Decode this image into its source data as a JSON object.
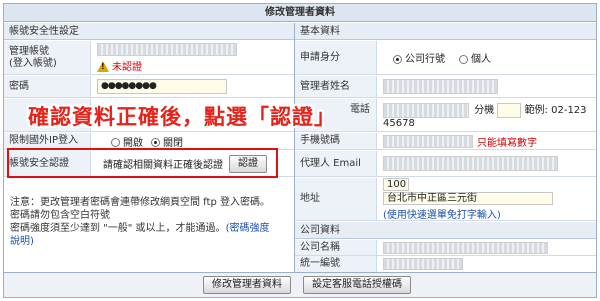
{
  "page": {
    "title": "修改管理者資料"
  },
  "left": {
    "section_title": "帳號安全性設定",
    "account": {
      "label_line1": "管理帳號",
      "label_line2": "(登入帳號)",
      "status": "未認證"
    },
    "password": {
      "label": "密碼",
      "value": "●●●●●●●●"
    },
    "ip": {
      "label": "限制國外IP登入",
      "option_on": "開啟",
      "option_off": "關閉",
      "selected": "關閉"
    },
    "verify": {
      "label": "帳號安全認證",
      "text": "請確認相關資料正確後認證",
      "button": "認證"
    },
    "note": {
      "line1": "注意：更改管理者密碼會連帶修改網頁空間 ftp 登入密碼。",
      "line2": "密碼請勿包含空白符號",
      "line3_prefix": "密碼強度須至少達到 \"一般\" 或以上，才能通過。",
      "line3_link": "(密碼強度",
      "line4_link": "說明)"
    }
  },
  "right": {
    "section_title": "基本資料",
    "applicant": {
      "label": "申請身分",
      "option_company": "公司行號",
      "option_personal": "個人",
      "selected": "公司行號"
    },
    "manager_name": {
      "label": "管理者姓名"
    },
    "phone": {
      "label_suffix": "電話",
      "ext_label": "分機",
      "example": "範例: 02-123",
      "example_cont": "45678"
    },
    "mobile": {
      "label": "手機號碼",
      "hint": "只能填寫數字"
    },
    "agent_email": {
      "label": "代理人 Email"
    },
    "address": {
      "label": "地址",
      "zip": "100",
      "street": "台北市中正區三元街",
      "quick_link": "(使用快速選單免打字輸入)"
    },
    "company_section_title": "公司資料",
    "company_name": {
      "label": "公司名稱"
    },
    "tax_id": {
      "label": "統一編號"
    }
  },
  "overlay": {
    "text": "確認資料正確後，點選「認證」"
  },
  "buttons": {
    "modify": "修改管理者資料",
    "phone_auth": "設定客服電話授權碼"
  }
}
